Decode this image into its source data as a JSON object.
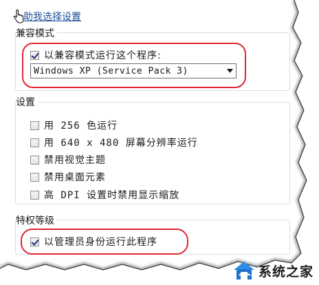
{
  "help_link": "助我选择设置",
  "compat": {
    "title": "兼容模式",
    "checkbox_label": "以兼容模式运行这个程序:",
    "checked": true,
    "select_value": "Windows XP (Service Pack 3)"
  },
  "settings": {
    "title": "设置",
    "items": [
      {
        "label": "用 256 色运行",
        "checked": false
      },
      {
        "label": "用 640 x 480 屏幕分辨率运行",
        "checked": false
      },
      {
        "label": "禁用视觉主题",
        "checked": false
      },
      {
        "label": "禁用桌面元素",
        "checked": false
      },
      {
        "label": "高 DPI 设置时禁用显示缩放",
        "checked": false
      }
    ]
  },
  "privilege": {
    "title": "特权等级",
    "checkbox_label": "以管理员身份运行此程序",
    "checked": true
  },
  "watermark": {
    "text": "系统之家"
  },
  "colors": {
    "highlight": "#e0222f",
    "link": "#1e4f9a",
    "group_border": "#d5dfe5"
  }
}
